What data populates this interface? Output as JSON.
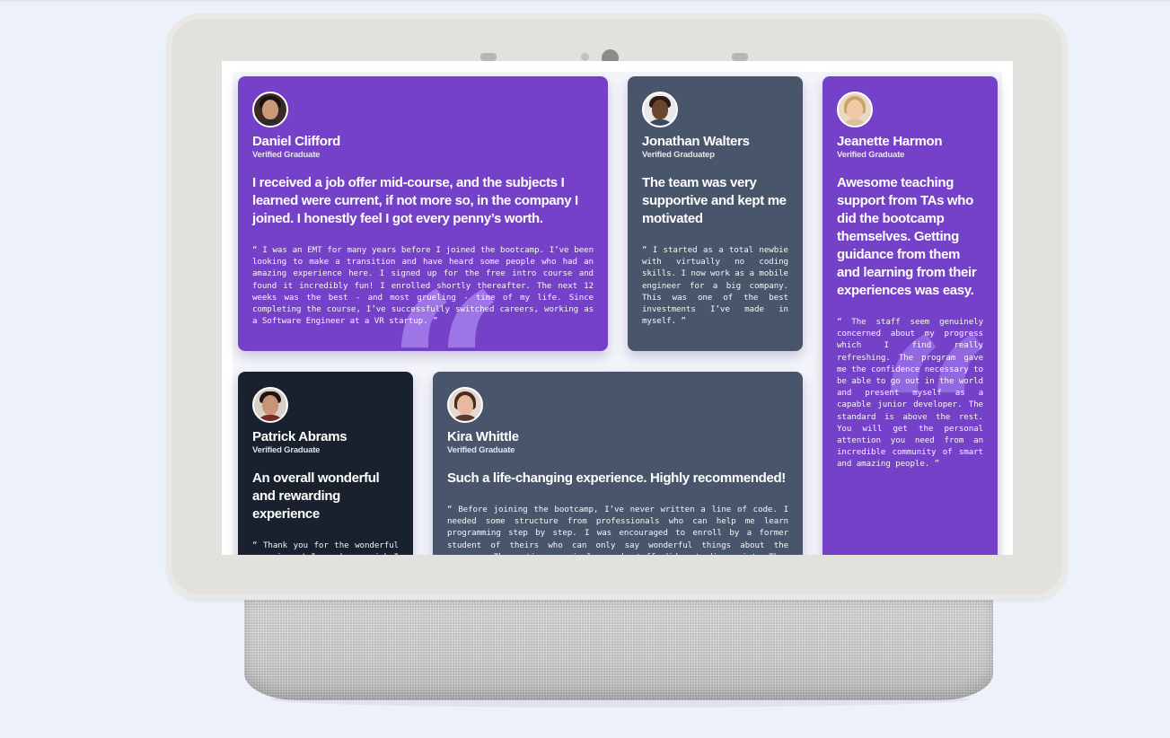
{
  "testimonials": [
    {
      "name": "Daniel Clifford",
      "role": "Verified Graduate",
      "headline": "I received a job offer mid-course, and the subjects I learned were current, if not more so, in the company I joined. I honestly feel I got every penny’s worth.",
      "body": "“ I was an EMT for many years before I joined the bootcamp. I’ve been looking to make a transition and have heard some people who had an amazing experience here. I signed up for the free intro course and found it incredibly fun! I enrolled shortly thereafter. The next 12 weeks was the best - and most grueling - time of my life. Since completing the course, I’ve successfully switched careers, working as a Software Engineer at a VR startup. ”"
    },
    {
      "name": "Jonathan Walters",
      "role": "Verified Graduatep",
      "headline": "The team was very supportive and kept me motivated",
      "body": "“ I started as a total newbie with virtually no coding skills. I now work as a mobile engineer for a big company. This was one of the best investments I’ve made in myself. ”"
    },
    {
      "name": "Jeanette Harmon",
      "role": "Verified Graduate",
      "headline": "Awesome teaching support from TAs who did the bootcamp themselves. Getting guidance from them and learning from their experiences was easy.",
      "body": "“ The staff seem genuinely concerned about my progress which I find really refreshing. The program gave me the confidence necessary to be able to go out in the world and present myself as a capable junior developer. The standard is above the rest. You will get the personal attention you need from an incredible community of smart and amazing people. ”"
    },
    {
      "name": "Patrick Abrams",
      "role": "Verified Graduate",
      "headline": "An overall wonderful and rewarding experience",
      "body": "“ Thank you for the wonderful experience! I now have a job I really enjoy, and make a good living while doing something I love. ”"
    },
    {
      "name": "Kira Whittle",
      "role": "Verified Graduate",
      "headline": "Such a life-changing experience. Highly recommended!",
      "body": "“ Before joining the bootcamp, I’ve never written a line of code. I needed some structure from professionals who can help me learn programming step by step. I was encouraged to enroll by a former student of theirs who can only say wonderful things about the program. The entire curriculum and staff did not disappoint. They were very hands-on and I never had to wait long for assistance. ”"
    }
  ],
  "icons": {
    "quote": "quote-icon",
    "quote_glyph": "“"
  },
  "colors": {
    "purple": "#7541c8",
    "slate": "#48556a",
    "dark": "#19212e",
    "background": "#edf2fa"
  }
}
